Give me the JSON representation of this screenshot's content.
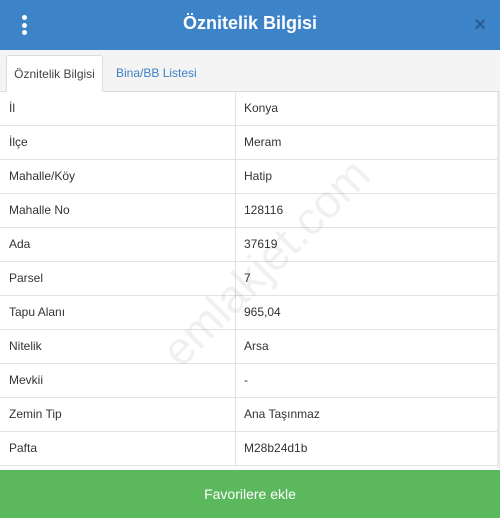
{
  "header": {
    "title": "Öznitelik Bilgisi",
    "close_glyph": "×"
  },
  "tabs": [
    {
      "label": "Öznitelik Bilgisi",
      "active": true
    },
    {
      "label": "Bina/BB Listesi",
      "active": false
    }
  ],
  "table": {
    "rows": [
      {
        "key": "İl",
        "value": "Konya"
      },
      {
        "key": "İlçe",
        "value": "Meram"
      },
      {
        "key": "Mahalle/Köy",
        "value": "Hatip"
      },
      {
        "key": "Mahalle No",
        "value": "128116"
      },
      {
        "key": "Ada",
        "value": "37619"
      },
      {
        "key": "Parsel",
        "value": "7"
      },
      {
        "key": "Tapu Alanı",
        "value": "965,04"
      },
      {
        "key": "Nitelik",
        "value": "Arsa"
      },
      {
        "key": "Mevkii",
        "value": "-"
      },
      {
        "key": "Zemin Tip",
        "value": "Ana Taşınmaz"
      },
      {
        "key": "Pafta",
        "value": "M28b24d1b"
      }
    ]
  },
  "watermark": "emlakjet.com",
  "footer": {
    "button_label": "Favorilere ekle"
  },
  "colors": {
    "header": "#3d83c7",
    "tab_link": "#3d7fc4",
    "button": "#5cb85c"
  }
}
